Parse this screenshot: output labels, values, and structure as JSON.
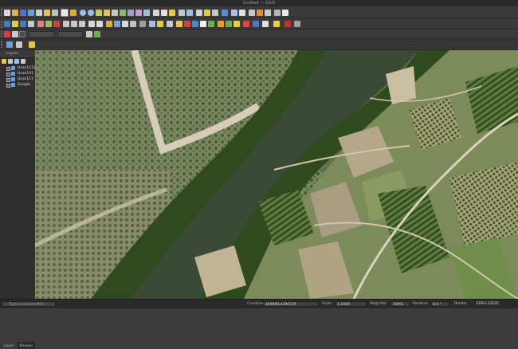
{
  "window": {
    "title": "Untitled — QGIS"
  },
  "layers_panel": {
    "header": "Layers",
    "items": [
      {
        "label": "Ucon1111",
        "checked": true
      },
      {
        "label": "Ucon101",
        "checked": true
      },
      {
        "label": "Ucon111",
        "checked": true
      },
      {
        "label": "Google",
        "checked": true
      }
    ],
    "tabs": [
      "Layers",
      "Browser"
    ]
  },
  "statusbar": {
    "locator_placeholder": "Type to locate (⌘K)",
    "coordinate_label": "Coordinate",
    "coordinate_value": "469960,4390729",
    "scale_label": "Scale",
    "scale_value": "1:1669",
    "magnifier_label": "Magnifier",
    "magnifier_value": "100%",
    "rotation_label": "Rotation",
    "rotation_value": "0.0 °",
    "render_label": "Render",
    "crs_value": "EPSG:32635"
  },
  "colors": {
    "river": "#3b4a35",
    "vegetation": "#2e4a1e",
    "olive_grove": "#6c7a55",
    "bare_field": "#b4a78a",
    "road": "#d5cdb8"
  }
}
